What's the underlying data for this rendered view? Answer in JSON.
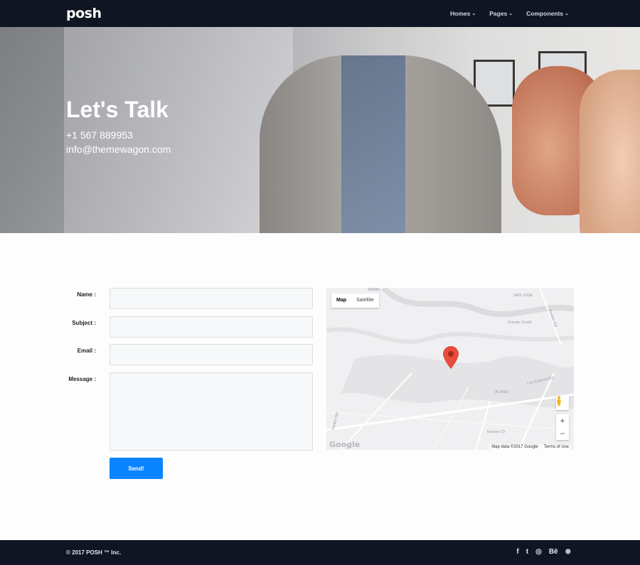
{
  "brand": {
    "logo": "posh"
  },
  "nav": {
    "items": [
      {
        "label": "Homes"
      },
      {
        "label": "Pages"
      },
      {
        "label": "Components"
      }
    ]
  },
  "hero": {
    "title": "Let's Talk",
    "phone": "+1 567 889953",
    "email": "info@themewagon.com"
  },
  "form": {
    "name_label": "Name :",
    "subject_label": "Subject :",
    "email_label": "Email :",
    "message_label": "Message :",
    "name_value": "",
    "subject_value": "",
    "email_value": "",
    "message_value": "",
    "send_label": "Send!",
    "accent": "#0a84ff"
  },
  "map": {
    "tabs": [
      {
        "label": "Map",
        "active": true
      },
      {
        "label": "Satellite",
        "active": false
      }
    ],
    "zoom_in": "+",
    "zoom_out": "−",
    "attribution": "Map data ©2017 Google",
    "terms": "Terms of Use",
    "watermark": "Google",
    "places": [
      "Wildlife",
      "ALVISO",
      "Coyote Creek",
      "SAN JOSE",
      "Los Esteros Rd",
      "Zanker Rd",
      "Tasman Dr",
      "Zanker Rd"
    ],
    "pin_color": "#e74c3c"
  },
  "footer": {
    "copyright": "© 2017 POSH ™ Inc.",
    "social": [
      {
        "name": "facebook-icon",
        "glyph": "f"
      },
      {
        "name": "twitter-icon",
        "glyph": "t"
      },
      {
        "name": "instagram-icon",
        "glyph": "◎"
      },
      {
        "name": "behance-icon",
        "glyph": "Bē"
      },
      {
        "name": "dribbble-icon",
        "glyph": "⊛"
      }
    ]
  },
  "colors": {
    "navbar": "#0f1522",
    "footer": "#0f1522",
    "accent": "#0a84ff"
  }
}
